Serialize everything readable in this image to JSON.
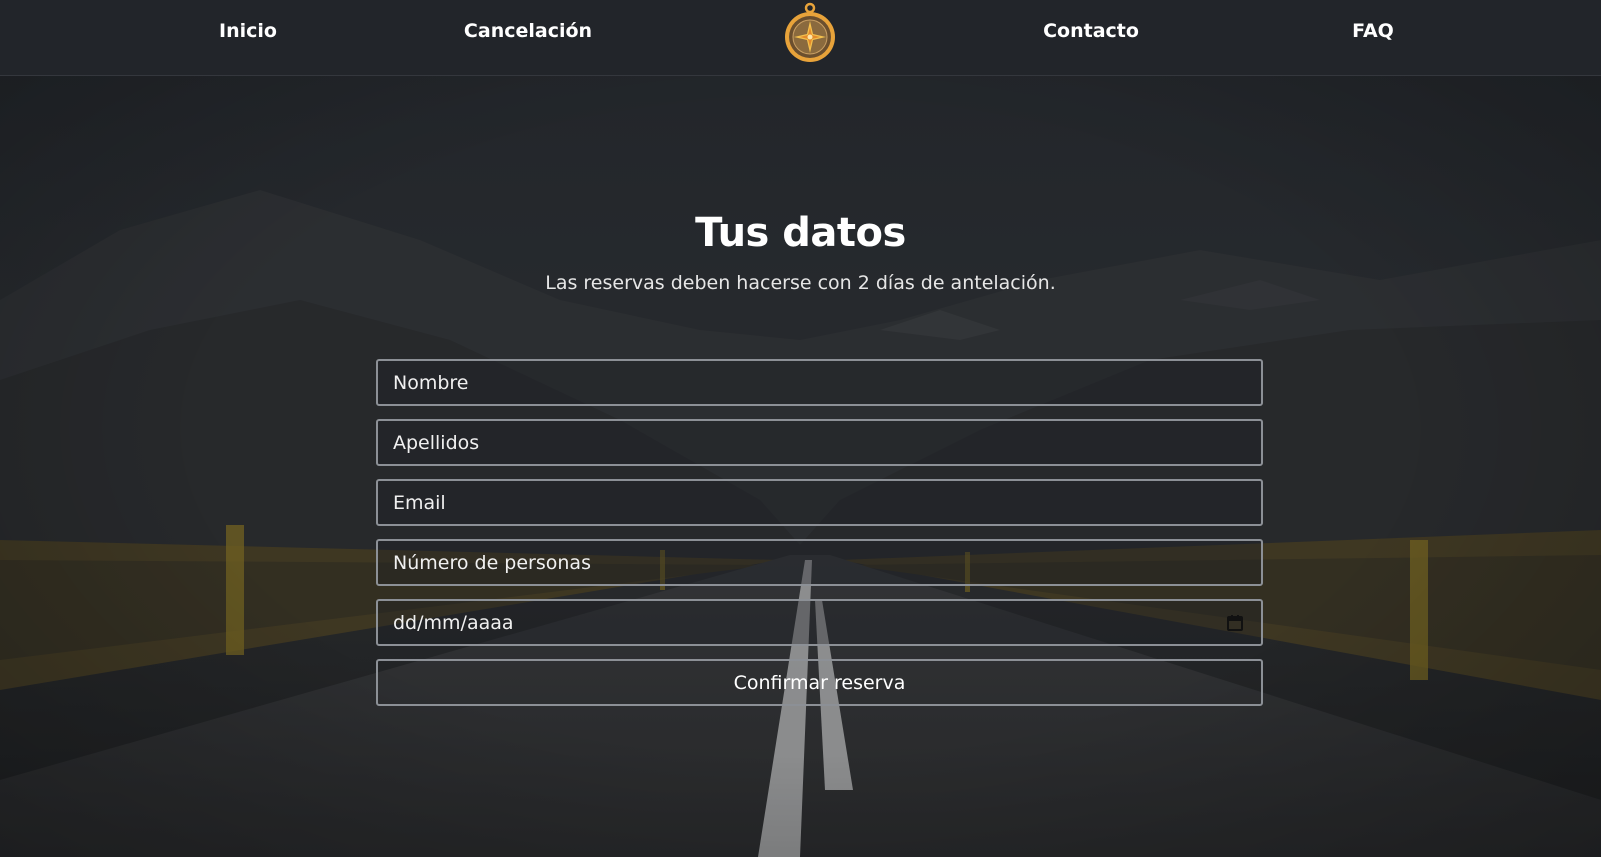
{
  "nav": {
    "items": [
      {
        "label": "Inicio"
      },
      {
        "label": "Cancelación"
      },
      {
        "label": "Contacto"
      },
      {
        "label": "FAQ"
      }
    ],
    "logo_icon": "compass-icon",
    "logo_color": "#e8a33a"
  },
  "hero": {
    "title": "Tus datos",
    "subtitle": "Las reservas deben hacerse con 2 días de antelación."
  },
  "form": {
    "nombre_placeholder": "Nombre",
    "apellidos_placeholder": "Apellidos",
    "email_placeholder": "Email",
    "personas_placeholder": "Número de personas",
    "date_placeholder": "dd/mm/aaaa",
    "date_icon": "calendar-icon",
    "submit_label": "Confirmar reserva"
  },
  "colors": {
    "nav_bg": "#22252a",
    "accent": "#e8a33a",
    "field_border": "#8c9096"
  }
}
